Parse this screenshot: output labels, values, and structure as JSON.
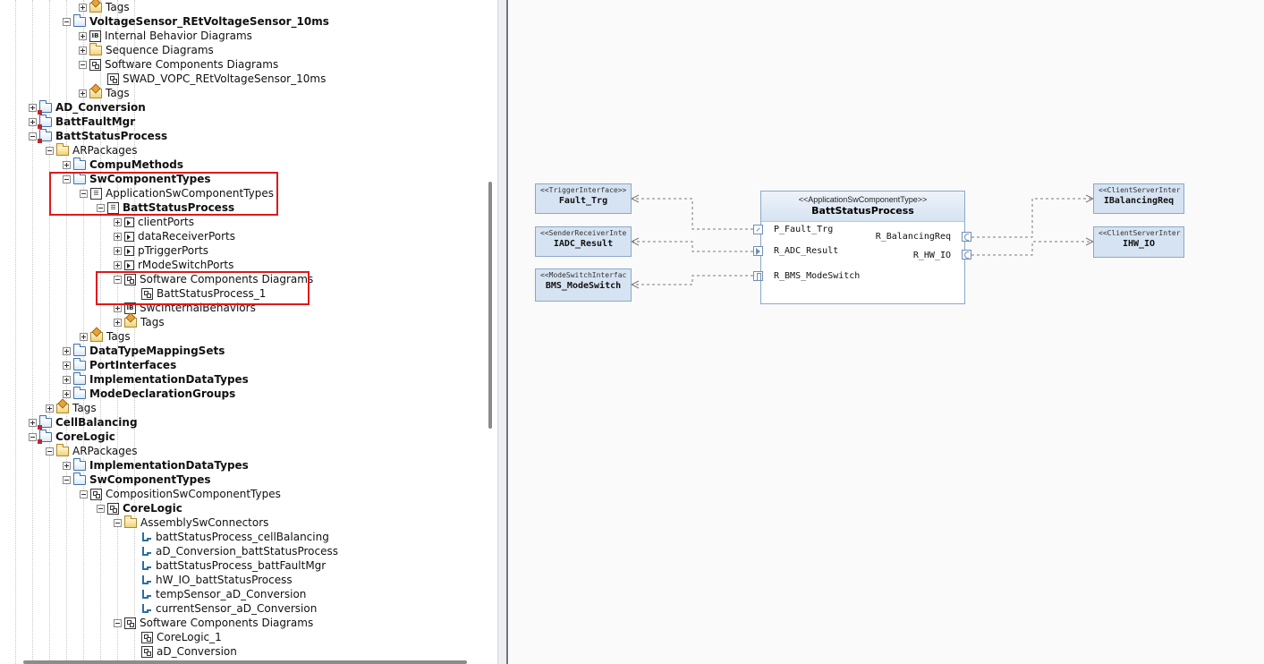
{
  "tree": [
    {
      "label": "Tags",
      "icon": "tags",
      "bold": false,
      "expander": "plus"
    },
    {
      "label": "VoltageSensor_REtVoltageSensor_10ms",
      "icon": "folder",
      "bold": true,
      "expander": "minus"
    },
    {
      "label": "Internal Behavior Diagrams",
      "icon": "ib",
      "bold": false,
      "expander": "plus"
    },
    {
      "label": "Sequence Diagrams",
      "icon": "yfolder",
      "bold": false,
      "expander": "plus"
    },
    {
      "label": "Software Components Diagrams",
      "icon": "comp",
      "bold": false,
      "expander": "minus"
    },
    {
      "label": "SWAD_VOPC_REtVoltageSensor_10ms",
      "icon": "comp",
      "bold": false,
      "expander": "none"
    },
    {
      "label": "Tags",
      "icon": "tags",
      "bold": false,
      "expander": "plus"
    },
    {
      "label": "AD_Conversion",
      "icon": "folder-red",
      "bold": true,
      "expander": "plus"
    },
    {
      "label": "BattFaultMgr",
      "icon": "folder-red",
      "bold": true,
      "expander": "plus"
    },
    {
      "label": "BattStatusProcess",
      "icon": "folder-red",
      "bold": true,
      "expander": "minus"
    },
    {
      "label": "ARPackages",
      "icon": "yfolder",
      "bold": false,
      "expander": "minus"
    },
    {
      "label": "CompuMethods",
      "icon": "folder",
      "bold": true,
      "expander": "plus"
    },
    {
      "label": "SwComponentTypes",
      "icon": "folder",
      "bold": true,
      "expander": "minus"
    },
    {
      "label": "ApplicationSwComponentTypes",
      "icon": "swc",
      "bold": false,
      "expander": "minus"
    },
    {
      "label": "BattStatusProcess",
      "icon": "swc",
      "bold": true,
      "expander": "minus"
    },
    {
      "label": "clientPorts",
      "icon": "port",
      "bold": false,
      "expander": "plus"
    },
    {
      "label": "dataReceiverPorts",
      "icon": "port",
      "bold": false,
      "expander": "plus"
    },
    {
      "label": "pTriggerPorts",
      "icon": "port",
      "bold": false,
      "expander": "plus"
    },
    {
      "label": "rModeSwitchPorts",
      "icon": "port",
      "bold": false,
      "expander": "plus"
    },
    {
      "label": "Software Components Diagrams",
      "icon": "comp",
      "bold": false,
      "expander": "minus"
    },
    {
      "label": "BattStatusProcess_1",
      "icon": "comp",
      "bold": false,
      "expander": "none"
    },
    {
      "label": "SwcInternalBehaviors",
      "icon": "ib",
      "bold": false,
      "expander": "plus"
    },
    {
      "label": "Tags",
      "icon": "tags",
      "bold": false,
      "expander": "plus"
    },
    {
      "label": "Tags",
      "icon": "tags",
      "bold": false,
      "expander": "plus"
    },
    {
      "label": "DataTypeMappingSets",
      "icon": "folder",
      "bold": true,
      "expander": "plus"
    },
    {
      "label": "PortInterfaces",
      "icon": "folder",
      "bold": true,
      "expander": "plus"
    },
    {
      "label": "ImplementationDataTypes",
      "icon": "folder",
      "bold": true,
      "expander": "plus"
    },
    {
      "label": "ModeDeclarationGroups",
      "icon": "folder",
      "bold": true,
      "expander": "plus"
    },
    {
      "label": "Tags",
      "icon": "tags",
      "bold": false,
      "expander": "plus"
    },
    {
      "label": "CellBalancing",
      "icon": "folder-red",
      "bold": true,
      "expander": "plus"
    },
    {
      "label": "CoreLogic",
      "icon": "folder-red",
      "bold": true,
      "expander": "minus"
    },
    {
      "label": "ARPackages",
      "icon": "yfolder",
      "bold": false,
      "expander": "minus"
    },
    {
      "label": "ImplementationDataTypes",
      "icon": "folder",
      "bold": true,
      "expander": "plus"
    },
    {
      "label": "SwComponentTypes",
      "icon": "folder",
      "bold": true,
      "expander": "minus"
    },
    {
      "label": "CompositionSwComponentTypes",
      "icon": "composition",
      "bold": false,
      "expander": "minus"
    },
    {
      "label": "CoreLogic",
      "icon": "composition",
      "bold": true,
      "expander": "minus"
    },
    {
      "label": "AssemblySwConnectors",
      "icon": "yfolder",
      "bold": false,
      "expander": "minus"
    },
    {
      "label": "battStatusProcess_cellBalancing",
      "icon": "connector",
      "bold": false,
      "expander": "none"
    },
    {
      "label": "aD_Conversion_battStatusProcess",
      "icon": "connector",
      "bold": false,
      "expander": "none"
    },
    {
      "label": "battStatusProcess_battFaultMgr",
      "icon": "connector",
      "bold": false,
      "expander": "none"
    },
    {
      "label": "hW_IO_battStatusProcess",
      "icon": "connector",
      "bold": false,
      "expander": "none"
    },
    {
      "label": "tempSensor_aD_Conversion",
      "icon": "connector",
      "bold": false,
      "expander": "none"
    },
    {
      "label": "currentSensor_aD_Conversion",
      "icon": "connector",
      "bold": false,
      "expander": "none"
    },
    {
      "label": "Software Components Diagrams",
      "icon": "comp",
      "bold": false,
      "expander": "minus"
    },
    {
      "label": "CoreLogic_1",
      "icon": "comp",
      "bold": false,
      "expander": "none"
    },
    {
      "label": "aD_Conversion",
      "icon": "comp",
      "bold": false,
      "expander": "none"
    }
  ],
  "highlight_color": "#e01919",
  "diagram": {
    "component": {
      "stereotype": "<<ApplicationSwComponentType>>",
      "name": "BattStatusProcess",
      "left_ports": [
        "P_Fault_Trg",
        "R_ADC_Result",
        "R_BMS_ModeSwitch"
      ],
      "right_ports": [
        "R_BalancingReq",
        "R_HW_IO"
      ]
    },
    "interfaces": [
      {
        "stereotype": "<<TriggerInterface>>",
        "name": "Fault_Trg"
      },
      {
        "stereotype": "<<SenderReceiverInte",
        "name": "IADC_Result"
      },
      {
        "stereotype": "<<ModeSwitchInterfac",
        "name": "BMS_ModeSwitch"
      },
      {
        "stereotype": "<<ClientServerInter",
        "name": "IBalancingReq"
      },
      {
        "stereotype": "<<ClientServerInter",
        "name": "IHW_IO"
      }
    ],
    "colors": {
      "box_fill": "#d6e3f2",
      "box_border": "#8aa8c9",
      "link": "#7a7a7a"
    }
  }
}
